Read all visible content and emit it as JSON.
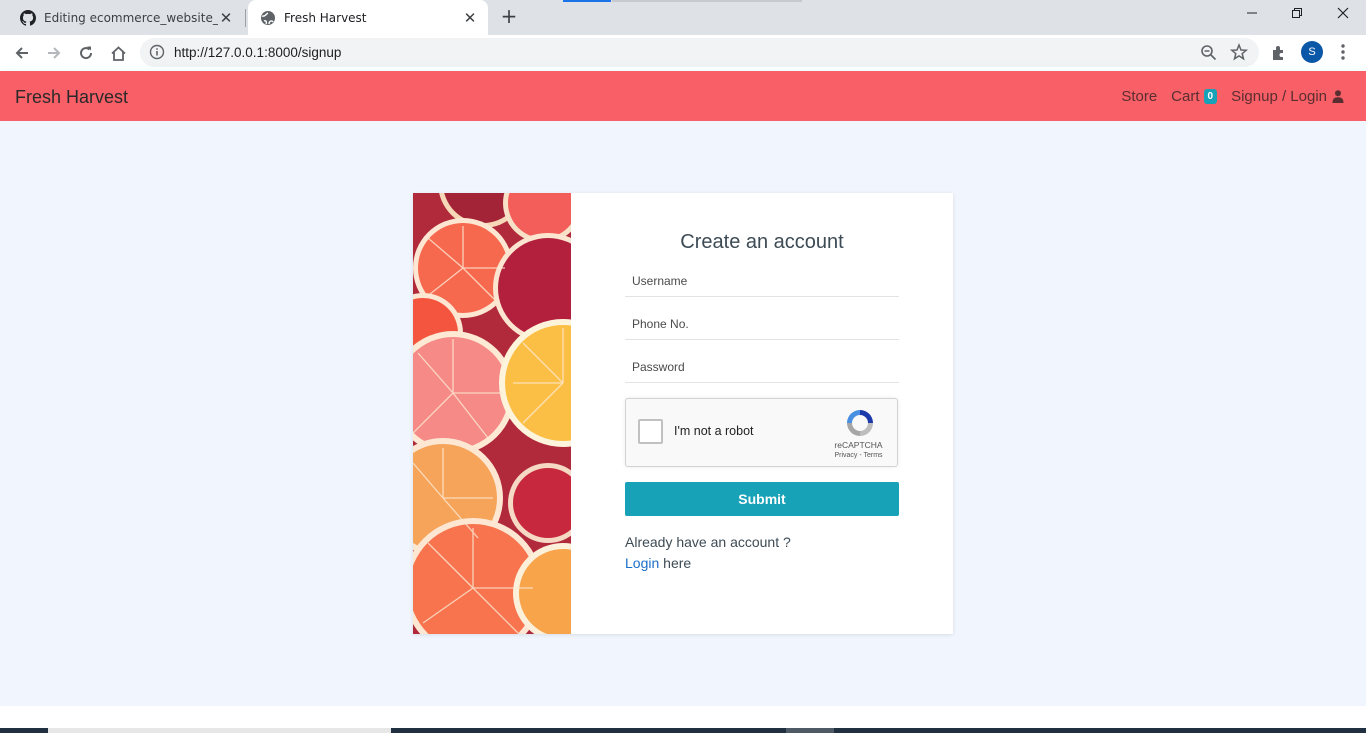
{
  "browser": {
    "tabs": [
      {
        "title": "Editing ecommerce_website_djan",
        "icon": "github-icon"
      },
      {
        "title": "Fresh Harvest",
        "icon": "globe-icon"
      }
    ],
    "new_tab_label": "+",
    "url": "http://127.0.0.1:8000/signup",
    "profile_initial": "S"
  },
  "navbar": {
    "brand": "Fresh Harvest",
    "links": {
      "store": "Store",
      "cart": "Cart",
      "cart_count": "0",
      "signup_login": "Signup / Login"
    },
    "color": "#f85f67"
  },
  "signup": {
    "title": "Create an account",
    "fields": {
      "username_placeholder": "Username",
      "phone_placeholder": "Phone No.",
      "password_placeholder": "Password"
    },
    "captcha": {
      "label": "I'm not a robot",
      "brand": "reCAPTCHA",
      "links": "Privacy - Terms"
    },
    "submit_label": "Submit",
    "login_prompt": "Already have an account ?",
    "login_link": "Login",
    "login_suffix": " here",
    "accent": "#17a2b8"
  }
}
